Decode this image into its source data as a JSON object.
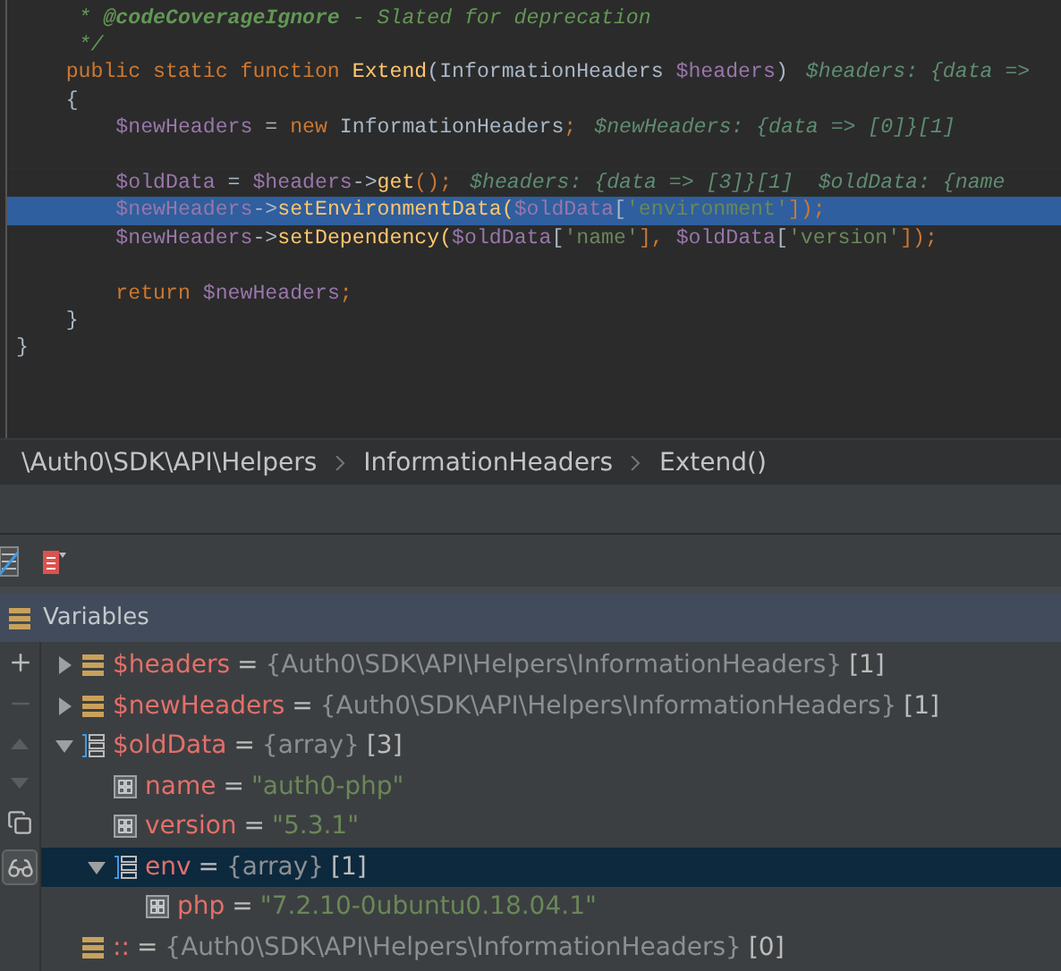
{
  "editor": {
    "lines": [
      {
        "tokens": [
          {
            "text": "     * ",
            "kind": "comment"
          },
          {
            "text": "@codeCoverageIgnore",
            "kind": "tag"
          },
          {
            "text": " - Slated for deprecation",
            "kind": "comment"
          }
        ],
        "selected": false
      },
      {
        "tokens": [
          {
            "text": "     */",
            "kind": "comment"
          }
        ],
        "selected": false
      },
      {
        "tokens": [
          {
            "text": "    public static function ",
            "kind": "keyword"
          },
          {
            "text": "Extend",
            "kind": "function"
          },
          {
            "text": "(InformationHeaders ",
            "kind": "plain"
          },
          {
            "text": "$headers",
            "kind": "variable"
          },
          {
            "text": ")",
            "kind": "plain"
          }
        ],
        "hint": "$headers: {data =>",
        "selected": false
      },
      {
        "tokens": [
          {
            "text": "    {",
            "kind": "plain"
          }
        ],
        "selected": false
      },
      {
        "tokens": [
          {
            "text": "        $newHeaders",
            "kind": "variable"
          },
          {
            "text": " = ",
            "kind": "plain"
          },
          {
            "text": "new ",
            "kind": "keyword"
          },
          {
            "text": "InformationHeaders",
            "kind": "plain"
          },
          {
            "text": ";",
            "kind": "keyword"
          }
        ],
        "hint": "$newHeaders: {data => [0]}[1]",
        "selected": false,
        "space_after": true
      },
      {
        "tokens": [
          {
            "text": "        $oldData",
            "kind": "variable"
          },
          {
            "text": " = ",
            "kind": "plain"
          },
          {
            "text": "$headers",
            "kind": "variable"
          },
          {
            "text": "->",
            "kind": "plain"
          },
          {
            "text": "get",
            "kind": "function"
          },
          {
            "text": "();",
            "kind": "keyword"
          }
        ],
        "hint": "$headers: {data => [3]}[1]  $oldData: {name",
        "selected": false
      },
      {
        "tokens": [
          {
            "text": "        $newHeaders",
            "kind": "variable"
          },
          {
            "text": "->",
            "kind": "plain"
          },
          {
            "text": "setEnvironmentData",
            "kind": "function"
          },
          {
            "text": "(",
            "kind": "function"
          },
          {
            "text": "$oldData",
            "kind": "variable"
          },
          {
            "text": "[",
            "kind": "plain"
          },
          {
            "text": "'environment'",
            "kind": "string"
          },
          {
            "text": "]);",
            "kind": "keyword"
          }
        ],
        "selected": true
      },
      {
        "tokens": [
          {
            "text": "        $newHeaders",
            "kind": "variable"
          },
          {
            "text": "->",
            "kind": "plain"
          },
          {
            "text": "setDependency",
            "kind": "function"
          },
          {
            "text": "(",
            "kind": "function"
          },
          {
            "text": "$oldData",
            "kind": "variable"
          },
          {
            "text": "[",
            "kind": "plain"
          },
          {
            "text": "'name'",
            "kind": "string"
          },
          {
            "text": "], ",
            "kind": "keyword"
          },
          {
            "text": "$oldData",
            "kind": "variable"
          },
          {
            "text": "[",
            "kind": "plain"
          },
          {
            "text": "'version'",
            "kind": "string"
          },
          {
            "text": "]);",
            "kind": "keyword"
          }
        ],
        "selected": false,
        "space_after": true
      },
      {
        "tokens": [
          {
            "text": "        return ",
            "kind": "keyword"
          },
          {
            "text": "$newHeaders",
            "kind": "variable"
          },
          {
            "text": ";",
            "kind": "keyword"
          }
        ],
        "selected": false
      },
      {
        "tokens": [
          {
            "text": "    }",
            "kind": "plain"
          }
        ],
        "selected": false
      },
      {
        "tokens": [
          {
            "text": "}",
            "kind": "plain"
          }
        ],
        "selected": false
      }
    ]
  },
  "breadcrumb": [
    "\\Auth0\\SDK\\API\\Helpers",
    "InformationHeaders",
    "Extend()"
  ],
  "variables": {
    "title": "Variables",
    "items": [
      {
        "name": "$headers",
        "operator": "=",
        "value": "{Auth0\\SDK\\API\\Helpers\\InformationHeaders}",
        "count": "[1]",
        "kind": "object",
        "expanded": false,
        "selected": false
      },
      {
        "name": "$newHeaders",
        "operator": "=",
        "value": "{Auth0\\SDK\\API\\Helpers\\InformationHeaders}",
        "count": "[1]",
        "kind": "object",
        "expanded": false,
        "selected": false
      },
      {
        "name": "$oldData",
        "operator": "=",
        "value": "{array}",
        "count": "[3]",
        "kind": "array",
        "expanded": true,
        "selected": false,
        "children": [
          {
            "name": "name",
            "operator": "=",
            "value": "\"auth0-php\"",
            "kind": "scalar",
            "selected": false
          },
          {
            "name": "version",
            "operator": "=",
            "value": "\"5.3.1\"",
            "kind": "scalar",
            "selected": false
          },
          {
            "name": "env",
            "operator": "=",
            "value": "{array}",
            "count": "[1]",
            "kind": "array",
            "expanded": true,
            "selected": true,
            "children": [
              {
                "name": "php",
                "operator": "=",
                "value": "\"7.2.10-0ubuntu0.18.04.1\"",
                "kind": "scalar",
                "selected": false
              }
            ]
          }
        ]
      },
      {
        "name": "::",
        "operator": "=",
        "value": "{Auth0\\SDK\\API\\Helpers\\InformationHeaders}",
        "count": "[0]",
        "kind": "object",
        "selected": false
      }
    ]
  }
}
